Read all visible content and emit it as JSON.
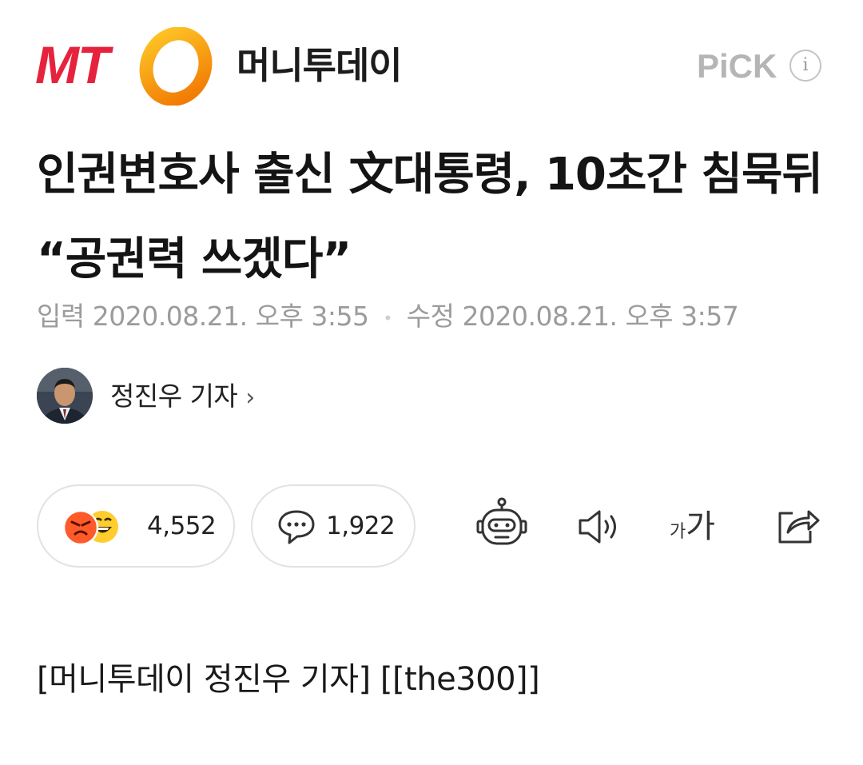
{
  "header": {
    "logo_mt": "MT",
    "logo_name": "머니투데이",
    "pick_label": "PiCK",
    "info_icon": "i",
    "logo_ring_colors": [
      "#f8b500",
      "#f07a00"
    ]
  },
  "article": {
    "headline": "인권변호사 출신 文대통령, 10초간 침묵뒤 “공권력 쓰겠다”",
    "input_label": "입력",
    "input_time": "2020.08.21. 오후 3:55",
    "modified_label": "수정",
    "modified_time": "2020.08.21. 오후 3:57",
    "author_name": "정진우 기자",
    "author_chevron": "›",
    "body_first_line": "[머니투데이 정진우 기자] [[the300]]"
  },
  "actions": {
    "reaction_count": "4,552",
    "comment_count": "1,922",
    "font_size_small": "가",
    "font_size_large": "가"
  },
  "colors": {
    "brand_red": "#e6233d",
    "meta_gray": "#9b9b9b"
  }
}
